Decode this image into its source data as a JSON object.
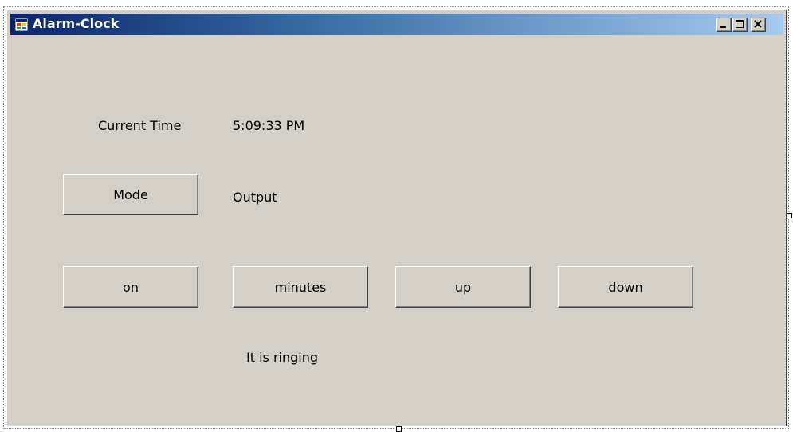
{
  "window": {
    "title": "Alarm-Clock",
    "icon": "windows-form-icon",
    "controls": {
      "minimize_icon": "minimize-icon",
      "maximize_icon": "maximize-icon",
      "close_icon": "close-icon"
    }
  },
  "colors": {
    "face": "#d4d0c8",
    "titlebar_start": "#0a246a",
    "titlebar_end": "#a6caf0",
    "text": "#000000"
  },
  "form": {
    "current_time_label": "Current Time",
    "current_time_value": "5:09:33 PM",
    "mode_button": "Mode",
    "output_label": "Output",
    "buttons": {
      "on": "on",
      "minutes": "minutes",
      "up": "up",
      "down": "down"
    },
    "status_text": "It is ringing"
  }
}
